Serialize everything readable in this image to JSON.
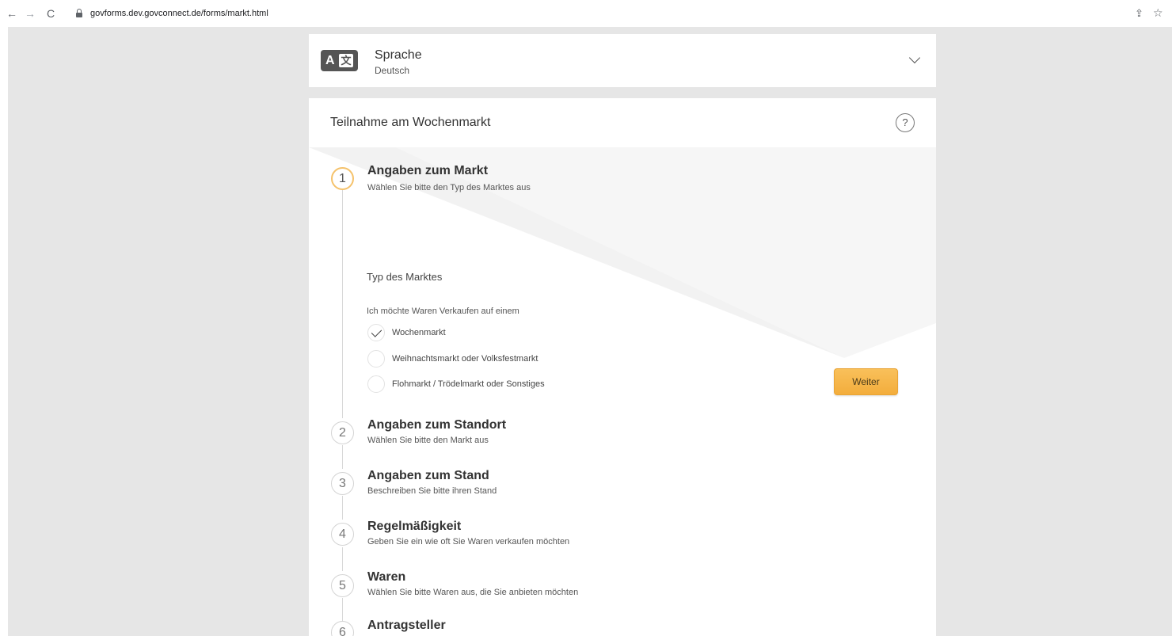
{
  "browser": {
    "url": "govforms.dev.govconnect.de/forms/markt.html",
    "back_glyph": "←",
    "forward_glyph": "→",
    "reload_glyph": "C",
    "share_glyph": "⇪",
    "star_glyph": "☆"
  },
  "language": {
    "icon_letter": "A",
    "icon_glyph": "文",
    "title": "Sprache",
    "value": "Deutsch"
  },
  "form": {
    "title": "Teilnahme am Wochenmarkt",
    "help_label": "?",
    "accent_color": "#f7b84a",
    "active_step": {
      "number": "1",
      "title": "Angaben zum Markt",
      "subtitle": "Wählen Sie bitte den Typ des Marktes aus",
      "section_label": "Typ des Marktes",
      "question": "Ich möchte Waren Verkaufen auf einem",
      "options": [
        {
          "label": "Wochenmarkt",
          "selected": true
        },
        {
          "label": "Weihnachtsmarkt oder Volksfestmarkt",
          "selected": false
        },
        {
          "label": "Flohmarkt / Trödelmarkt oder Sonstiges",
          "selected": false
        }
      ],
      "next_button": "Weiter"
    },
    "steps": [
      {
        "number": "2",
        "title": "Angaben zum Standort",
        "subtitle": "Wählen Sie bitte den Markt aus"
      },
      {
        "number": "3",
        "title": "Angaben zum Stand",
        "subtitle": "Beschreiben Sie bitte ihren Stand"
      },
      {
        "number": "4",
        "title": "Regelmäßigkeit",
        "subtitle": "Geben Sie ein wie oft Sie Waren verkaufen möchten"
      },
      {
        "number": "5",
        "title": "Waren",
        "subtitle": "Wählen Sie bitte Waren aus, die Sie anbieten möchten"
      },
      {
        "number": "6",
        "title": "Antragsteller",
        "subtitle": ""
      }
    ]
  }
}
